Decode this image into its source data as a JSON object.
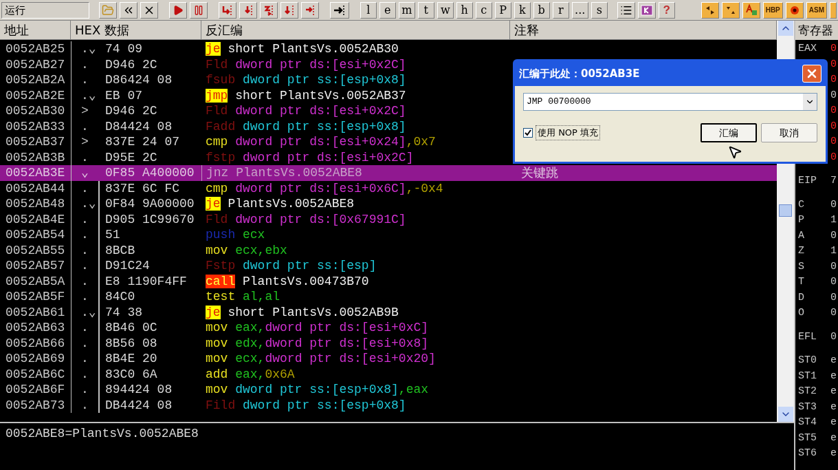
{
  "toolbar": {
    "status": "运行",
    "letter_buttons": [
      "l",
      "e",
      "m",
      "t",
      "w",
      "h",
      "c",
      "P",
      "k",
      "b",
      "r",
      "...",
      "s"
    ],
    "help": "?",
    "plugin_labels": [
      "HBP",
      "ASM"
    ]
  },
  "columns": [
    "地址",
    "HEX 数据",
    "反汇编",
    "注释"
  ],
  "rows": [
    {
      "address": "0052AB25",
      "mark": ".⌄",
      "hex": "74 09",
      "selected": false,
      "tokens": [
        {
          "kind": "jump",
          "text": "je"
        },
        {
          "kind": "plain",
          "text": " short PlantsVs.0052AB30"
        }
      ]
    },
    {
      "address": "0052AB27",
      "mark": ".",
      "hex": "D946 2C",
      "selected": false,
      "tokens": [
        {
          "kind": "fpu",
          "text": "Fld"
        },
        {
          "kind": "mem_ds",
          "text": " dword ptr ds:[esi+0x2C]"
        }
      ]
    },
    {
      "address": "0052AB2A",
      "mark": ".",
      "hex": "D86424 08",
      "selected": false,
      "tokens": [
        {
          "kind": "fpu",
          "text": "fsub"
        },
        {
          "kind": "mem_ss",
          "text": " dword ptr ss:[esp+0x8]"
        }
      ]
    },
    {
      "address": "0052AB2E",
      "mark": ".⌄",
      "hex": "EB 07",
      "selected": false,
      "tokens": [
        {
          "kind": "jump",
          "text": "jmp"
        },
        {
          "kind": "plain",
          "text": " short PlantsVs.0052AB37"
        }
      ]
    },
    {
      "address": "0052AB30",
      "mark": ">",
      "hex": "D946 2C",
      "selected": false,
      "tokens": [
        {
          "kind": "fpu",
          "text": "Fld"
        },
        {
          "kind": "mem_ds",
          "text": " dword ptr ds:[esi+0x2C]"
        }
      ]
    },
    {
      "address": "0052AB33",
      "mark": ".",
      "hex": "D84424 08",
      "selected": false,
      "tokens": [
        {
          "kind": "fpu",
          "text": "Fadd"
        },
        {
          "kind": "mem_ss",
          "text": " dword ptr ss:[esp+0x8]"
        }
      ]
    },
    {
      "address": "0052AB37",
      "mark": ">",
      "hex": "837E 24 07",
      "selected": false,
      "tokens": [
        {
          "kind": "op",
          "text": "cmp"
        },
        {
          "kind": "mem_ds",
          "text": " dword ptr ds:[esi+0x24]"
        },
        {
          "kind": "const",
          "text": ",0x7"
        }
      ]
    },
    {
      "address": "0052AB3B",
      "mark": ".",
      "hex": "D95E 2C",
      "selected": false,
      "tokens": [
        {
          "kind": "fpu",
          "text": "fstp"
        },
        {
          "kind": "mem_ds",
          "text": " dword ptr ds:[esi+0x2C]"
        }
      ]
    },
    {
      "address": "0052AB3E",
      "mark": "⌄",
      "hex": "0F85 A400000",
      "selected": true,
      "comment": "关键跳",
      "tokens": [
        {
          "kind": "plain",
          "text": "jnz PlantsVs.0052ABE8"
        }
      ]
    },
    {
      "address": "0052AB44",
      "mark": ".",
      "hex": "837E 6C FC",
      "selected": false,
      "tokens": [
        {
          "kind": "op",
          "text": "cmp"
        },
        {
          "kind": "mem_ds",
          "text": " dword ptr ds:[esi+0x6C]"
        },
        {
          "kind": "const",
          "text": ",-0x4"
        }
      ]
    },
    {
      "address": "0052AB48",
      "mark": ".⌄",
      "hex": "0F84 9A00000",
      "selected": false,
      "tokens": [
        {
          "kind": "jump",
          "text": "je"
        },
        {
          "kind": "plain",
          "text": " PlantsVs.0052ABE8"
        }
      ]
    },
    {
      "address": "0052AB4E",
      "mark": ".",
      "hex": "D905 1C99670",
      "selected": false,
      "tokens": [
        {
          "kind": "fpu",
          "text": "Fld"
        },
        {
          "kind": "mem_ds",
          "text": " dword ptr ds:[0x67991C]"
        }
      ]
    },
    {
      "address": "0052AB54",
      "mark": ".",
      "hex": "51",
      "selected": false,
      "tokens": [
        {
          "kind": "push",
          "text": "push"
        },
        {
          "kind": "reg",
          "text": " ecx"
        }
      ]
    },
    {
      "address": "0052AB55",
      "mark": ".",
      "hex": "8BCB",
      "selected": false,
      "tokens": [
        {
          "kind": "op",
          "text": "mov"
        },
        {
          "kind": "reg",
          "text": " ecx,ebx"
        }
      ]
    },
    {
      "address": "0052AB57",
      "mark": ".",
      "hex": "D91C24",
      "selected": false,
      "tokens": [
        {
          "kind": "fpu",
          "text": "Fstp"
        },
        {
          "kind": "mem_ss",
          "text": " dword ptr ss:[esp]"
        }
      ]
    },
    {
      "address": "0052AB5A",
      "mark": ".",
      "hex": "E8 1190F4FF",
      "selected": false,
      "tokens": [
        {
          "kind": "call",
          "text": "call"
        },
        {
          "kind": "plain",
          "text": " PlantsVs.00473B70"
        }
      ]
    },
    {
      "address": "0052AB5F",
      "mark": ".",
      "hex": "84C0",
      "selected": false,
      "tokens": [
        {
          "kind": "op",
          "text": "test"
        },
        {
          "kind": "reg",
          "text": " al,al"
        }
      ]
    },
    {
      "address": "0052AB61",
      "mark": ".⌄",
      "hex": "74 38",
      "selected": false,
      "tokens": [
        {
          "kind": "jump",
          "text": "je"
        },
        {
          "kind": "plain",
          "text": " short PlantsVs.0052AB9B"
        }
      ]
    },
    {
      "address": "0052AB63",
      "mark": ".",
      "hex": "8B46 0C",
      "selected": false,
      "tokens": [
        {
          "kind": "op",
          "text": "mov"
        },
        {
          "kind": "reg",
          "text": " eax,"
        },
        {
          "kind": "mem_ds",
          "text": "dword ptr ds:[esi+0xC]"
        }
      ]
    },
    {
      "address": "0052AB66",
      "mark": ".",
      "hex": "8B56 08",
      "selected": false,
      "tokens": [
        {
          "kind": "op",
          "text": "mov"
        },
        {
          "kind": "reg",
          "text": " edx,"
        },
        {
          "kind": "mem_ds",
          "text": "dword ptr ds:[esi+0x8]"
        }
      ]
    },
    {
      "address": "0052AB69",
      "mark": ".",
      "hex": "8B4E 20",
      "selected": false,
      "tokens": [
        {
          "kind": "op",
          "text": "mov"
        },
        {
          "kind": "reg",
          "text": " ecx,"
        },
        {
          "kind": "mem_ds",
          "text": "dword ptr ds:[esi+0x20]"
        }
      ]
    },
    {
      "address": "0052AB6C",
      "mark": ".",
      "hex": "83C0 6A",
      "selected": false,
      "tokens": [
        {
          "kind": "op",
          "text": "add"
        },
        {
          "kind": "reg",
          "text": " eax,"
        },
        {
          "kind": "const",
          "text": "0x6A"
        }
      ]
    },
    {
      "address": "0052AB6F",
      "mark": ".",
      "hex": "894424 08",
      "selected": false,
      "tokens": [
        {
          "kind": "op",
          "text": "mov"
        },
        {
          "kind": "mem_ss",
          "text": " dword ptr ss:[esp+0x8]"
        },
        {
          "kind": "reg",
          "text": ",eax"
        }
      ]
    },
    {
      "address": "0052AB73",
      "mark": ".",
      "hex": "DB4424 08",
      "selected": false,
      "tokens": [
        {
          "kind": "fpu",
          "text": "Fild"
        },
        {
          "kind": "mem_ss",
          "text": " dword ptr ss:[esp+0x8]"
        }
      ]
    }
  ],
  "info": "0052ABE8=PlantsVs.0052ABE8",
  "registers": {
    "title": "寄存器",
    "groups": [
      [
        {
          "name": "EAX",
          "value": "0",
          "changed": true
        },
        {
          "value": "0",
          "changed": true
        },
        {
          "value": "0",
          "changed": true
        },
        {
          "value": "0",
          "changed": false
        },
        {
          "value": "0",
          "changed": true
        },
        {
          "value": "0",
          "changed": true
        },
        {
          "value": "0",
          "changed": true
        },
        {
          "value": "0",
          "changed": true
        }
      ],
      [
        {
          "name": "EIP",
          "value": "7",
          "changed": false
        }
      ],
      [
        {
          "name": "C",
          "value": "0",
          "changed": false
        },
        {
          "name": "P",
          "value": "1",
          "changed": false
        },
        {
          "name": "A",
          "value": "0",
          "changed": false
        },
        {
          "name": "Z",
          "value": "1",
          "changed": false
        },
        {
          "name": "S",
          "value": "0",
          "changed": false
        },
        {
          "name": "T",
          "value": "0",
          "changed": false
        },
        {
          "name": "D",
          "value": "0",
          "changed": false
        },
        {
          "name": "O",
          "value": "0",
          "changed": false
        }
      ],
      [
        {
          "name": "EFL",
          "value": "0",
          "changed": false
        }
      ],
      [
        {
          "name": "ST0",
          "value": "e",
          "changed": false
        },
        {
          "name": "ST1",
          "value": "e",
          "changed": false
        },
        {
          "name": "ST2",
          "value": "e",
          "changed": false
        },
        {
          "name": "ST3",
          "value": "e",
          "changed": false
        },
        {
          "name": "ST4",
          "value": "e",
          "changed": false
        },
        {
          "name": "ST5",
          "value": "e",
          "changed": false
        },
        {
          "name": "ST6",
          "value": "e",
          "changed": false
        }
      ]
    ]
  },
  "dialog": {
    "title": "汇编于此处：0052AB3E",
    "command": "JMP 00700000",
    "nop_fill": {
      "label": "使用 NOP 填充",
      "checked": true
    },
    "buttons": [
      {
        "label": "汇编",
        "focused": true
      },
      {
        "label": "取消",
        "focused": false
      }
    ]
  }
}
